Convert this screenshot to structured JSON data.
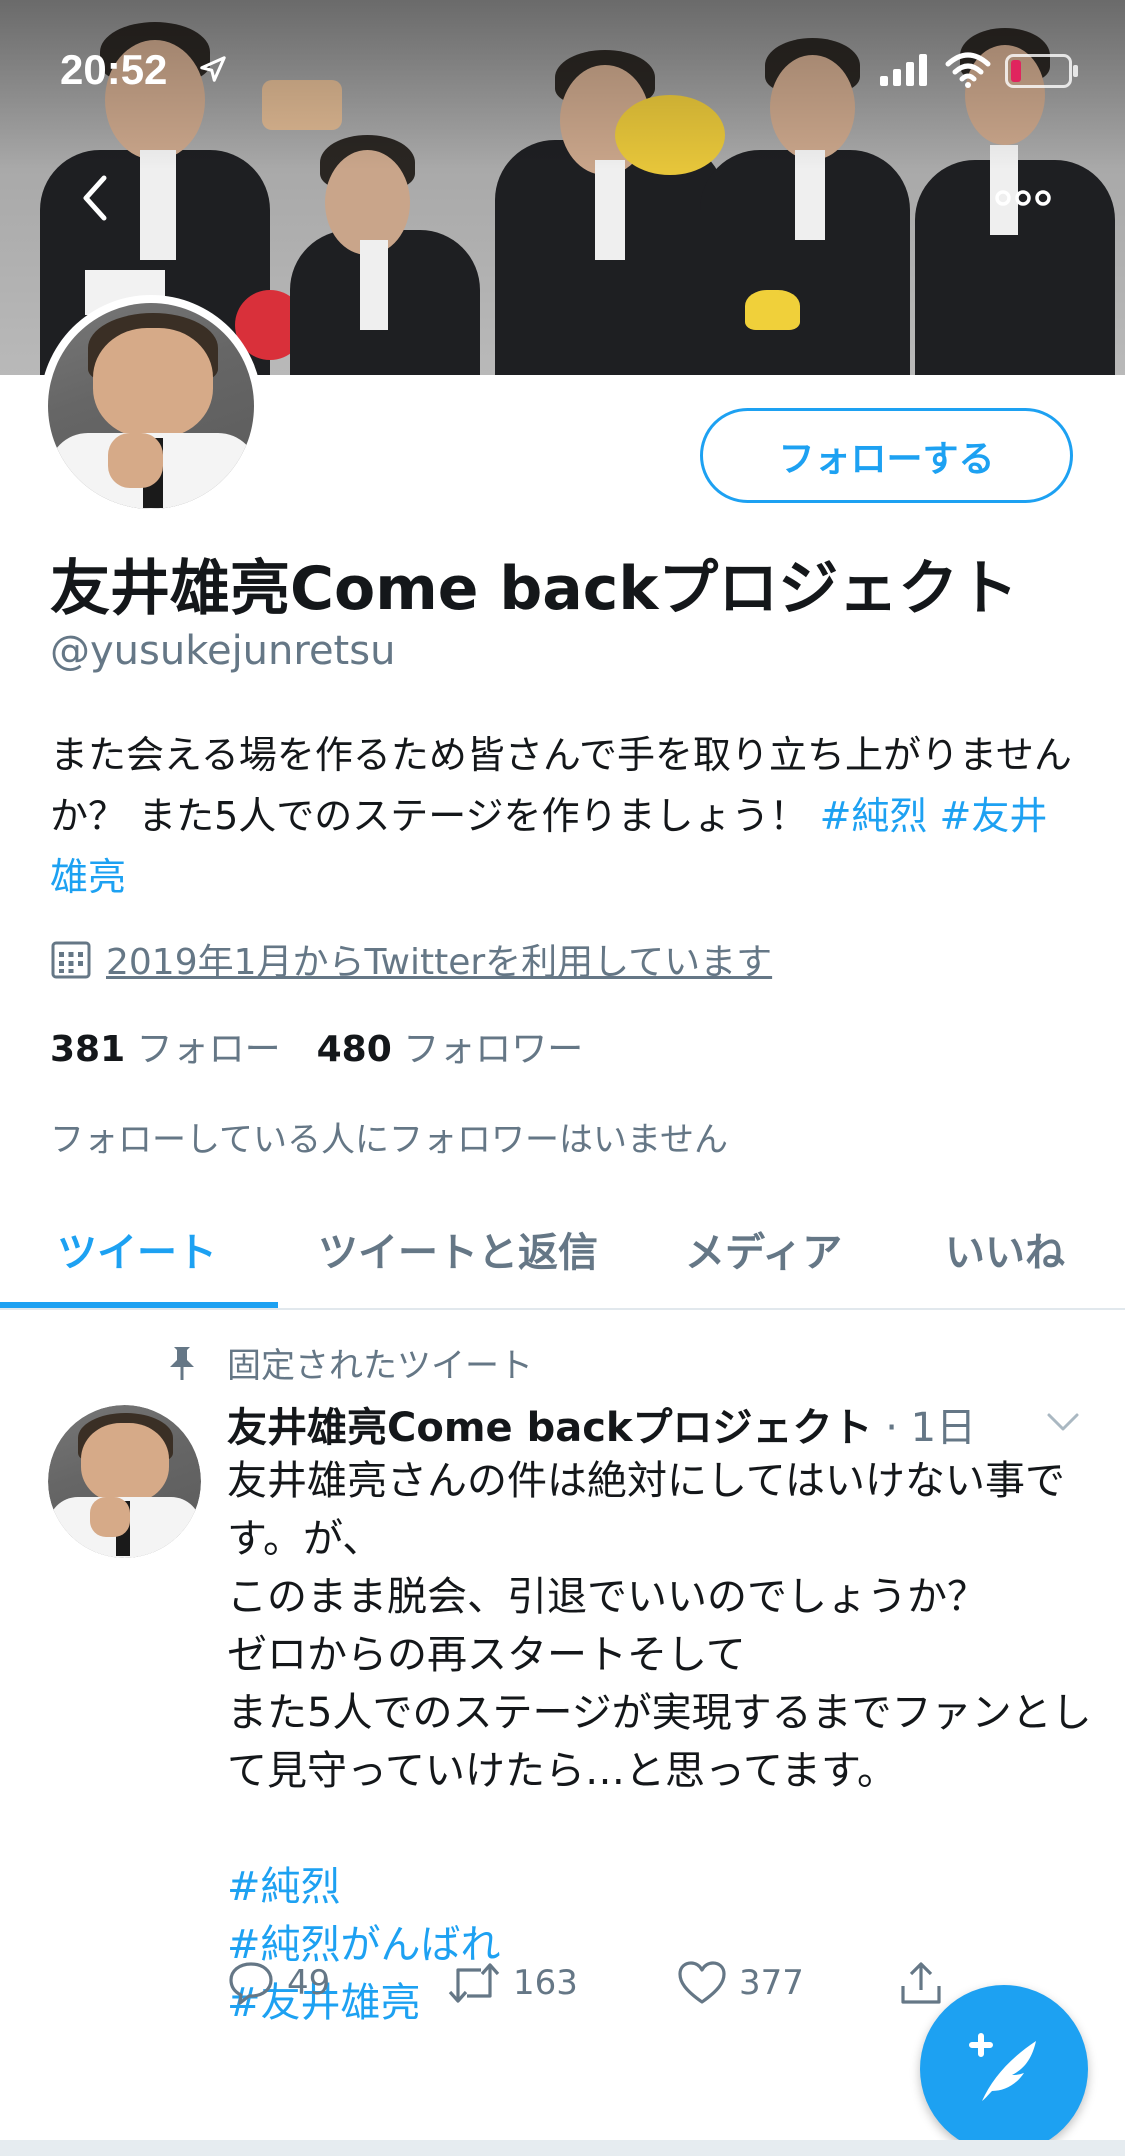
{
  "status_bar": {
    "time": "20:52",
    "icons": [
      "location-arrow-icon",
      "signal-icon",
      "wifi-icon",
      "battery-low-icon"
    ],
    "battery_color": "#e0245e"
  },
  "nav": {
    "back_icon": "chevron-left-icon",
    "more_icon": "more-dots-icon"
  },
  "profile": {
    "follow_label": "フォローする",
    "display_name": "友井雄亮Come backプロジェクト",
    "handle": "@yusukejunretsu",
    "bio_text": "また会える場を作るため皆さんで手を取り立ち上がりませんか？ また5人でのステージを作りましょう！ ",
    "bio_tags": [
      "#純烈",
      "#友井雄亮"
    ],
    "joined": "2019年1月からTwitterを利用しています",
    "following_count": "381",
    "following_label": "フォロー",
    "followers_count": "480",
    "followers_label": "フォロワー",
    "followed_by_note": "フォローしている人にフォロワーはいません"
  },
  "tabs": [
    {
      "label": "ツイート",
      "active": true
    },
    {
      "label": "ツイートと返信",
      "active": false
    },
    {
      "label": "メディア",
      "active": false
    },
    {
      "label": "いいね",
      "active": false
    }
  ],
  "tweet": {
    "pinned_label": "固定されたツイート",
    "author": "友井雄亮Come backプロジェクト",
    "meta": " · 1日",
    "text": "友井雄亮さんの件は絶対にしてはいけない事です。が、\nこのまま脱会、引退でいいのでしょうか？\nゼロからの再スタートそして\nまた5人でのステージが実現するまでファンとして見守っていけたら…と思ってます。",
    "hashtags": [
      "#純烈",
      "#純烈がんばれ",
      "#友井雄亮"
    ],
    "reply_count": "49",
    "retweet_count": "163",
    "like_count": "377"
  },
  "colors": {
    "accent": "#1da1f2",
    "text": "#14171a",
    "muted": "#657786"
  }
}
